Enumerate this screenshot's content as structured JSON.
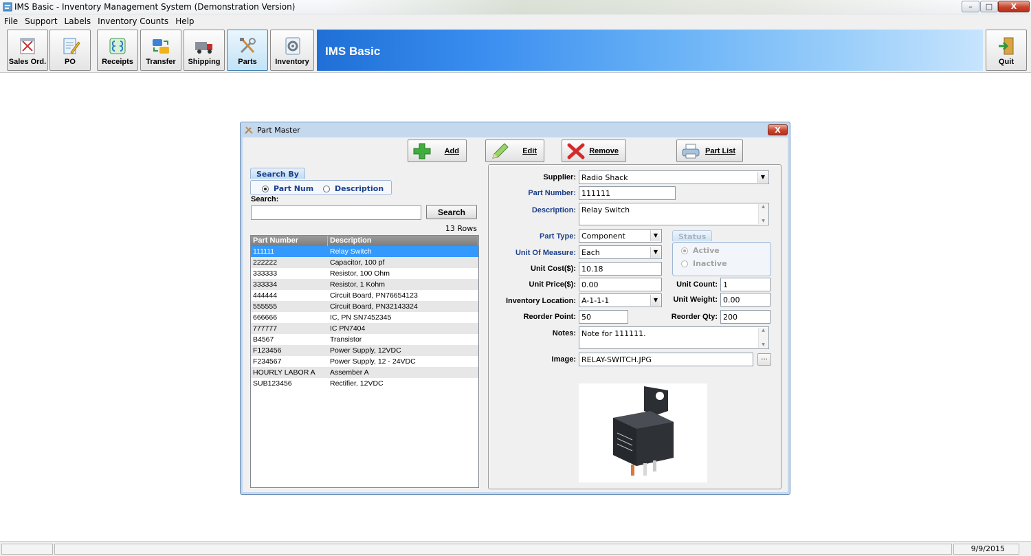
{
  "window": {
    "title": "IMS Basic - Inventory Management System (Demonstration Version)",
    "minimize": "–",
    "maximize": "□",
    "close": "X"
  },
  "menu": [
    "File",
    "Support",
    "Labels",
    "Inventory Counts",
    "Help"
  ],
  "toolbar": {
    "buttons": [
      "Sales Ord.",
      "PO",
      "Receipts",
      "Transfer",
      "Shipping",
      "Parts",
      "Inventory"
    ],
    "active": "Parts",
    "banner_title": "IMS Basic",
    "quit": "Quit"
  },
  "status_bar": {
    "date": "9/9/2015"
  },
  "dialog": {
    "title": "Part Master",
    "close": "X",
    "actions": {
      "add": "Add",
      "edit": "Edit",
      "remove": "Remove",
      "part_list": "Part List"
    },
    "search_by": {
      "legend": "Search By",
      "options": [
        "Part Num",
        "Description"
      ],
      "selected": "Part Num"
    },
    "search": {
      "label": "Search:",
      "value": "",
      "button": "Search",
      "row_count": "13 Rows"
    },
    "grid": {
      "columns": [
        "Part Number",
        "Description"
      ],
      "selected_index": 0,
      "rows": [
        [
          "111111",
          "Relay Switch"
        ],
        [
          "222222",
          "Capacitor, 100 pf"
        ],
        [
          "333333",
          "Resistor, 100 Ohm"
        ],
        [
          "333334",
          "Resistor, 1 Kohm"
        ],
        [
          "444444",
          "Circuit Board, PN76654123"
        ],
        [
          "555555",
          "Circuit Board, PN32143324"
        ],
        [
          "666666",
          "IC, PN SN7452345"
        ],
        [
          "777777",
          "IC PN7404"
        ],
        [
          "B4567",
          "Transistor"
        ],
        [
          "F123456",
          "Power Supply, 12VDC"
        ],
        [
          "F234567",
          "Power Supply, 12 - 24VDC"
        ],
        [
          "HOURLY LABOR A",
          "Assember A"
        ],
        [
          "SUB123456",
          "Rectifier, 12VDC"
        ]
      ]
    },
    "form": {
      "supplier": {
        "label": "Supplier:",
        "value": "Radio Shack"
      },
      "part_number": {
        "label": "Part Number:",
        "value": "111111"
      },
      "description": {
        "label": "Description:",
        "value": "Relay Switch"
      },
      "part_type": {
        "label": "Part Type:",
        "value": "Component"
      },
      "unit_of_measure": {
        "label": "Unit Of Measure:",
        "value": "Each"
      },
      "unit_cost": {
        "label": "Unit Cost($):",
        "value": "10.18"
      },
      "unit_price": {
        "label": "Unit Price($):",
        "value": "0.00"
      },
      "inventory_location": {
        "label": "Inventory Location:",
        "value": "A-1-1-1"
      },
      "reorder_point": {
        "label": "Reorder Point:",
        "value": "50"
      },
      "unit_count": {
        "label": "Unit Count:",
        "value": "1"
      },
      "unit_weight": {
        "label": "Unit Weight:",
        "value": "0.00"
      },
      "reorder_qty": {
        "label": "Reorder Qty:",
        "value": "200"
      },
      "notes": {
        "label": "Notes:",
        "value": "Note for 111111."
      },
      "image": {
        "label": "Image:",
        "value": "RELAY-SWITCH.JPG",
        "browse": "..."
      },
      "status": {
        "legend": "Status",
        "options": [
          "Active",
          "Inactive"
        ],
        "selected": "Active"
      }
    }
  }
}
